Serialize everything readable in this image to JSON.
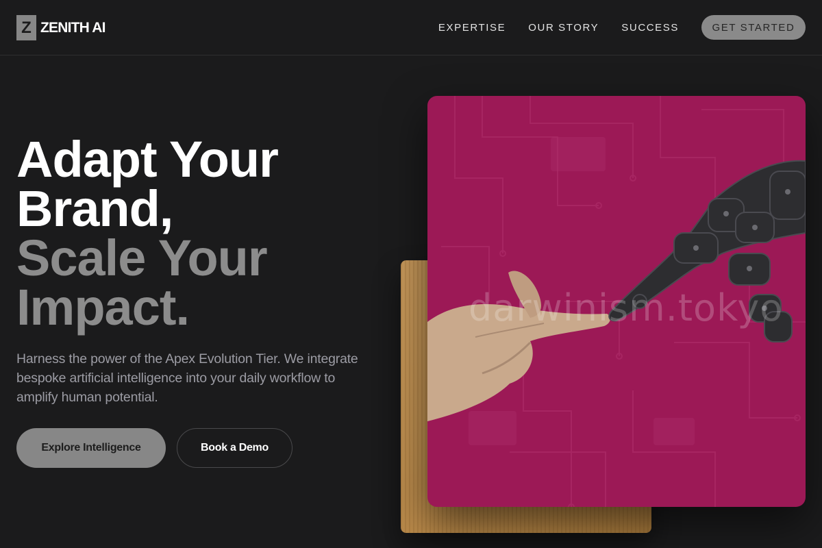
{
  "brand": {
    "mark": "Z",
    "name": "ZENITH AI"
  },
  "nav": {
    "links": [
      "EXPERTISE",
      "OUR STORY",
      "SUCCESS"
    ],
    "cta": "GET STARTED"
  },
  "hero": {
    "headline_white": [
      "Adapt Your",
      "Brand,"
    ],
    "headline_grey": [
      "Scale Your",
      "Impact."
    ],
    "subtext": "Harness the power of the Apex Evolution Tier. We integrate bespoke artificial intelligence into your daily workflow to amplify human potential.",
    "primary_button": "Explore Intelligence",
    "secondary_button": "Book a Demo"
  },
  "image": {
    "watermark": "darwinism.tokyo"
  },
  "colors": {
    "background": "#1b1b1c",
    "accent_grey": "#878787",
    "magenta": "#9c1956",
    "cardboard": "#c99a5c"
  }
}
